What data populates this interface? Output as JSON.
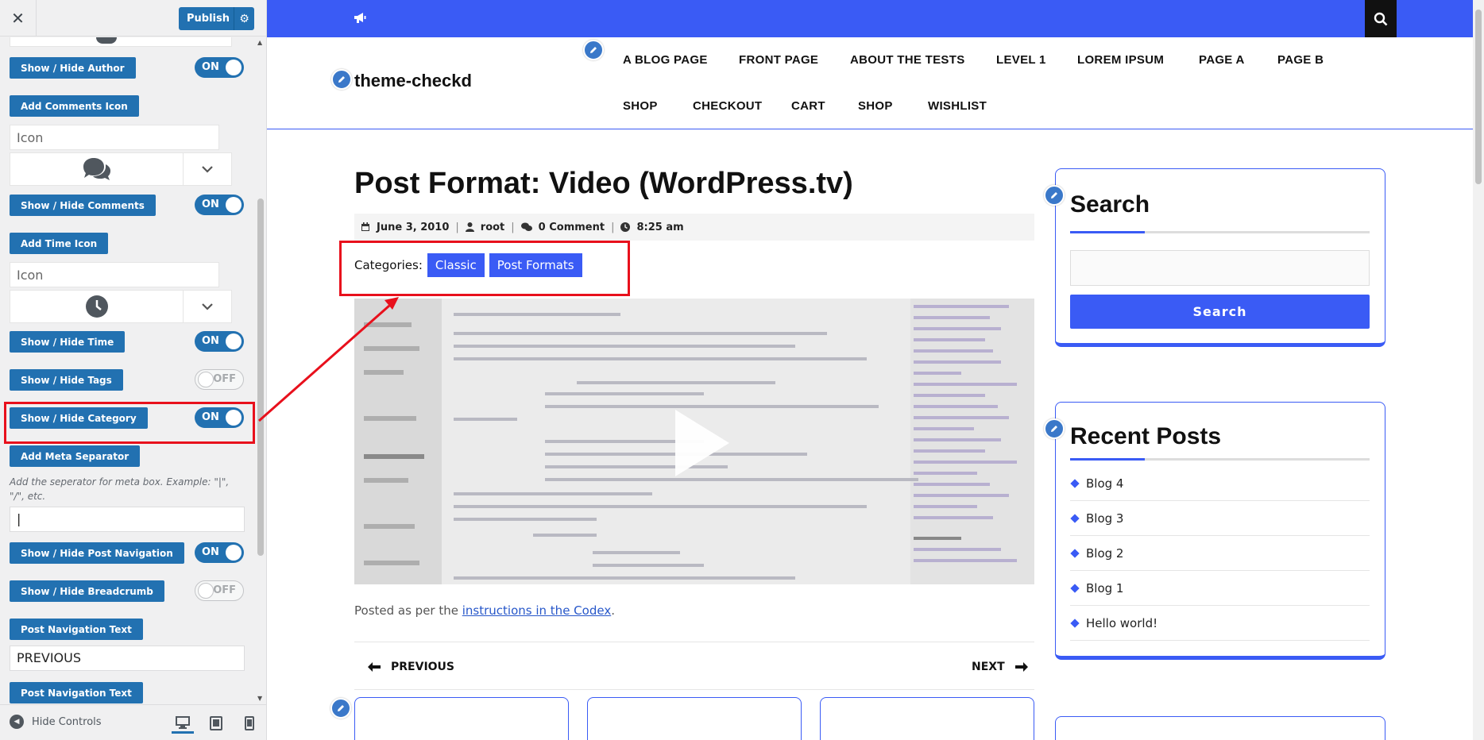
{
  "panel": {
    "publish_label": "Publish",
    "controls": {
      "show_hide_author": "Show / Hide Author",
      "author_toggle": "ON",
      "add_comments_icon": "Add Comments Icon",
      "comments_icon_placeholder": "Icon",
      "show_hide_comments": "Show / Hide Comments",
      "comments_toggle": "ON",
      "add_time_icon": "Add Time Icon",
      "time_icon_placeholder": "Icon",
      "show_hide_time": "Show / Hide Time",
      "time_toggle": "ON",
      "show_hide_tags": "Show / Hide Tags",
      "tags_toggle": "OFF",
      "show_hide_category": "Show / Hide Category",
      "category_toggle": "ON",
      "add_meta_separator": "Add Meta Separator",
      "separator_description": "Add the seperator for meta box. Example: \"|\", \"/\", etc.",
      "separator_value": "|",
      "show_hide_post_navigation": "Show / Hide Post Navigation",
      "post_navigation_toggle": "ON",
      "show_hide_breadcrumb": "Show / Hide Breadcrumb",
      "breadcrumb_toggle": "OFF",
      "post_navigation_text_1": "Post Navigation Text",
      "post_navigation_text_value": "PREVIOUS",
      "post_navigation_text_2": "Post Navigation Text"
    },
    "footer": {
      "hide_controls": "Hide Controls"
    }
  },
  "preview": {
    "site_title": "theme-checkd",
    "nav": [
      "A BLOG PAGE",
      "FRONT PAGE",
      "ABOUT THE TESTS",
      "LEVEL 1",
      "LOREM IPSUM",
      "PAGE A",
      "PAGE B",
      "SHOP",
      "CHECKOUT",
      "CART",
      "SHOP",
      "WISHLIST"
    ],
    "post": {
      "title": "Post Format: Video (WordPress.tv)",
      "date": "June 3, 2010",
      "author": "root",
      "comments": "0 Comment",
      "time": "8:25 am",
      "categories_label": "Categories:",
      "categories": [
        "Classic",
        "Post Formats"
      ],
      "posted_prefix": "Posted as per the ",
      "posted_link": "instructions in the Codex",
      "posted_suffix": ".",
      "previous": "PREVIOUS",
      "next": "NEXT"
    },
    "sidebar": {
      "search_title": "Search",
      "search_button": "Search",
      "recent_title": "Recent Posts",
      "recent_posts": [
        "Blog 4",
        "Blog 3",
        "Blog 2",
        "Blog 1",
        "Hello world!"
      ]
    }
  },
  "colors": {
    "accent": "#3a5bf5",
    "wp_blue": "#2271b1",
    "highlight_red": "#e8101c"
  }
}
